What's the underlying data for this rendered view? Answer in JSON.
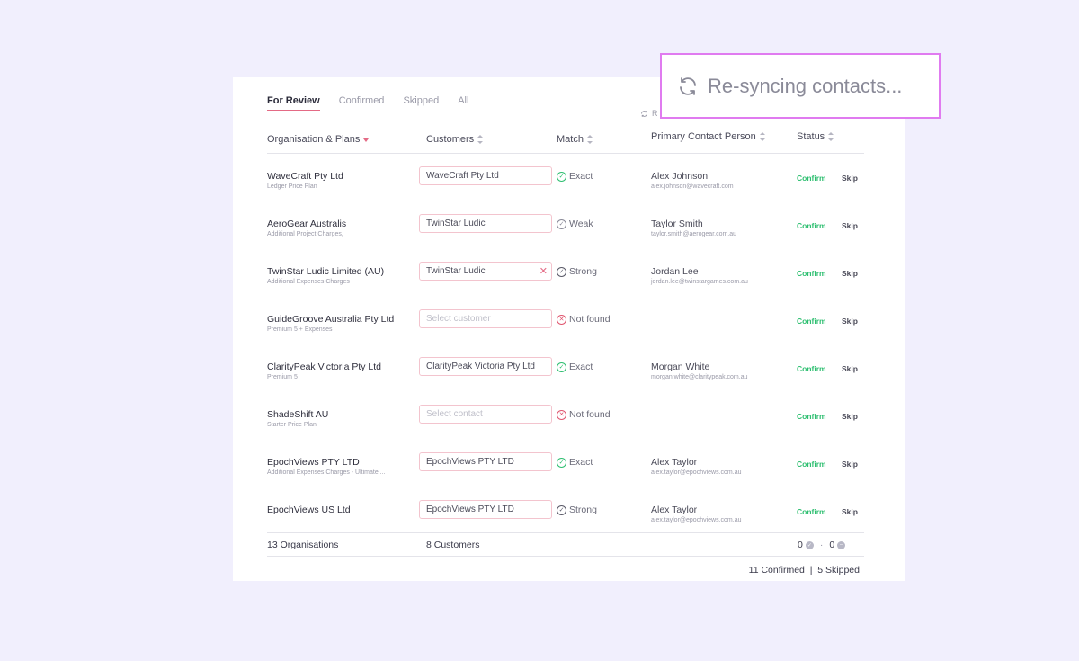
{
  "tabs": [
    {
      "label": "For Review",
      "active": true
    },
    {
      "label": "Confirmed",
      "active": false
    },
    {
      "label": "Skipped",
      "active": false
    },
    {
      "label": "All",
      "active": false
    }
  ],
  "resync_mini": "R",
  "columns": {
    "org": "Organisation & Plans",
    "customers": "Customers",
    "match": "Match",
    "contact": "Primary Contact Person",
    "status": "Status"
  },
  "rows": [
    {
      "org": "WaveCraft Pty Ltd",
      "plan": "Ledger Price Plan",
      "customer": "WaveCraft Pty Ltd",
      "customer_placeholder": false,
      "clearable": false,
      "match": "Exact",
      "match_type": "exact",
      "contact_name": "Alex Johnson",
      "contact_email": "alex.johnson@wavecraft.com",
      "confirm": "Confirm",
      "skip": "Skip"
    },
    {
      "org": "AeroGear Australis",
      "plan": "Additional Project Charges,",
      "customer": "TwinStar Ludic",
      "customer_placeholder": false,
      "clearable": false,
      "match": "Weak",
      "match_type": "weak",
      "contact_name": "Taylor Smith",
      "contact_email": "taylor.smith@aerogear.com.au",
      "confirm": "Confirm",
      "skip": "Skip"
    },
    {
      "org": "TwinStar Ludic Limited (AU)",
      "plan": "Additional Expenses Charges",
      "customer": "TwinStar Ludic",
      "customer_placeholder": false,
      "clearable": true,
      "match": "Strong",
      "match_type": "strong",
      "contact_name": "Jordan Lee",
      "contact_email": "jordan.lee@twinstargames.com.au",
      "confirm": "Confirm",
      "skip": "Skip"
    },
    {
      "org": "GuideGroove Australia Pty Ltd",
      "plan": "Premium 5 + Expenses",
      "customer": "Select customer",
      "customer_placeholder": true,
      "clearable": false,
      "match": "Not found",
      "match_type": "none",
      "contact_name": "",
      "contact_email": "",
      "confirm": "Confirm",
      "skip": "Skip"
    },
    {
      "org": "ClarityPeak Victoria Pty Ltd",
      "plan": "Premium 5",
      "customer": "ClarityPeak Victoria Pty Ltd",
      "customer_placeholder": false,
      "clearable": false,
      "match": "Exact",
      "match_type": "exact",
      "contact_name": "Morgan White",
      "contact_email": "morgan.white@claritypeak.com.au",
      "confirm": "Confirm",
      "skip": "Skip"
    },
    {
      "org": "ShadeShift AU",
      "plan": "Starter Price Plan",
      "customer": "Select contact",
      "customer_placeholder": true,
      "clearable": false,
      "match": "Not found",
      "match_type": "none",
      "contact_name": "",
      "contact_email": "",
      "confirm": "Confirm",
      "skip": "Skip"
    },
    {
      "org": "EpochViews PTY LTD",
      "plan": "Additional Expenses Charges - Ultimate ...",
      "customer": "EpochViews PTY LTD",
      "customer_placeholder": false,
      "clearable": false,
      "match": "Exact",
      "match_type": "exact",
      "contact_name": "Alex Taylor",
      "contact_email": "alex.taylor@epochviews.com.au",
      "confirm": "Confirm",
      "skip": "Skip"
    },
    {
      "org": "EpochViews US Ltd",
      "plan": "",
      "customer": "EpochViews PTY LTD",
      "customer_placeholder": false,
      "clearable": false,
      "match": "Strong",
      "match_type": "strong",
      "contact_name": "Alex Taylor",
      "contact_email": "alex.taylor@epochviews.com.au",
      "confirm": "Confirm",
      "skip": "Skip"
    }
  ],
  "footer": {
    "orgs": "13 Organisations",
    "customers": "8 Customers",
    "count_a": "0",
    "sep": "·",
    "count_b": "0"
  },
  "summary": "11 Confirmed  |  5 Skipped",
  "toast": {
    "text": "Re-syncing contacts..."
  },
  "colors": {
    "accent": "#e46a85",
    "confirm": "#2fbf71",
    "not_found": "#e0566f",
    "toast_border": "#e07bf0",
    "background": "#f1effd"
  }
}
